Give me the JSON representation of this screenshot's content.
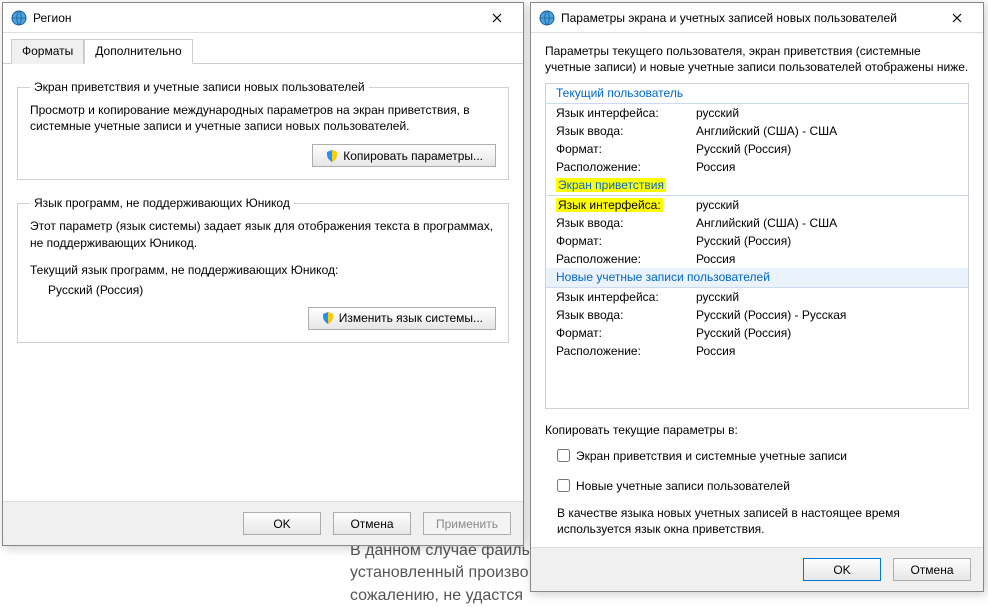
{
  "bgtext": {
    "line1": "В данном случае файлы",
    "line2": "установленный произво",
    "line3": "сожалению, не удастся"
  },
  "win1": {
    "title": "Регион",
    "tabs": {
      "formats": "Форматы",
      "add": "Дополнительно"
    },
    "group1": {
      "legend": "Экран приветствия и учетные записи новых пользователей",
      "desc": "Просмотр и копирование международных параметров на экран приветствия, в системные учетные записи и учетные записи новых пользователей.",
      "btn": "Копировать параметры..."
    },
    "group2": {
      "legend": "Язык программ, не поддерживающих Юникод",
      "desc": "Этот параметр (язык системы) задает язык для отображения текста в программах, не поддерживающих Юникод.",
      "curlabel": "Текущий язык программ, не поддерживающих Юникод:",
      "curvalue": "Русский (Россия)",
      "btn": "Изменить язык системы..."
    },
    "buttons": {
      "ok": "OK",
      "cancel": "Отмена",
      "apply": "Применить"
    }
  },
  "win2": {
    "title": "Параметры экрана и учетных записей новых пользователей",
    "intro": "Параметры текущего пользователя, экран приветствия (системные учетные записи) и новые учетные записи пользователей отображены ниже.",
    "sections": {
      "current": {
        "header": "Текущий пользователь"
      },
      "welcome": {
        "header": "Экран приветствия"
      },
      "newu": {
        "header": "Новые учетные записи пользователей"
      }
    },
    "labels": {
      "ui": "Язык интерфейса:",
      "input": "Язык ввода:",
      "format": "Формат:",
      "loc": "Расположение:"
    },
    "values": {
      "current": {
        "ui": "русский",
        "input": "Английский (США) - США",
        "format": "Русский (Россия)",
        "loc": "Россия"
      },
      "welcome": {
        "ui": "русский",
        "input": "Английский (США) - США",
        "format": "Русский (Россия)",
        "loc": "Россия"
      },
      "newu": {
        "ui": "русский",
        "input": "Русский (Россия) - Русская",
        "format": "Русский (Россия)",
        "loc": "Россия"
      }
    },
    "copyto": "Копировать текущие параметры в:",
    "chk1": "Экран приветствия и системные учетные записи",
    "chk2": "Новые учетные записи пользователей",
    "note": "В качестве языка новых учетных записей в настоящее время используется язык окна приветствия.",
    "buttons": {
      "ok": "OK",
      "cancel": "Отмена"
    }
  }
}
